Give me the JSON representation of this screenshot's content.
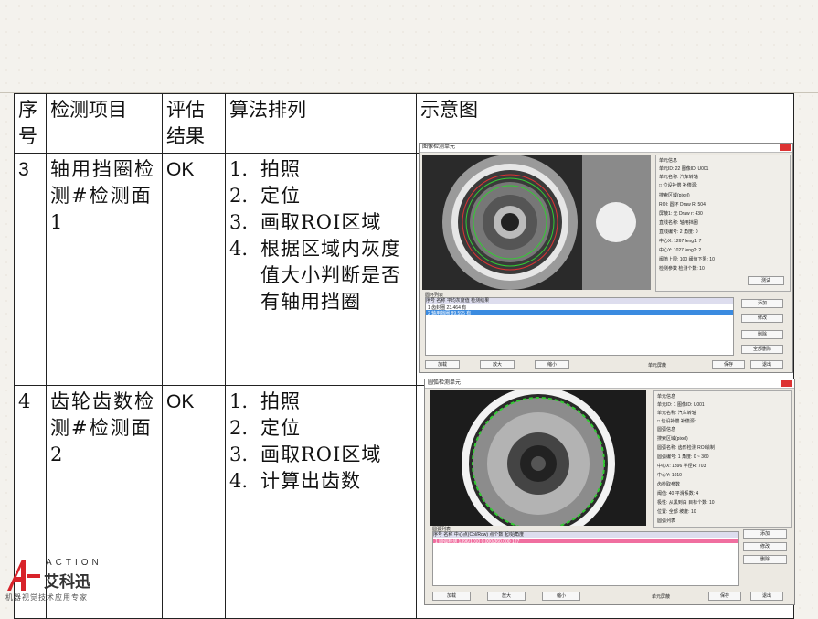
{
  "table": {
    "headers": [
      "序号",
      "检测项目",
      "评估结果",
      "算法排列",
      "示意图"
    ],
    "rows": [
      {
        "seq": "3",
        "item": "轴用挡圈检测#检测面1",
        "result": "OK",
        "steps": [
          {
            "n": "1.",
            "t": "拍照"
          },
          {
            "n": "2.",
            "t": "定位"
          },
          {
            "n": "3.",
            "t": "画取ROI区域"
          },
          {
            "n": "4.",
            "t": "根据区域内灰度值大小判断是否有轴用挡圈"
          }
        ]
      },
      {
        "seq": "4",
        "item": "齿轮齿数检测#检测面2",
        "result": "OK",
        "steps": [
          {
            "n": "1.",
            "t": "拍照"
          },
          {
            "n": "2.",
            "t": "定位"
          },
          {
            "n": "3.",
            "t": "画取ROI区域"
          },
          {
            "n": "4.",
            "t": "计算出齿数"
          }
        ]
      }
    ]
  },
  "shot1": {
    "title": "图像检测单元",
    "fields": [
      "单元信息",
      "单元ID: 22   图像ID: U001",
      "单元名称: 汽车转轴",
      "□ 位设补偿   补偿源:",
      "搜索区域(pixel)",
      "ROI: 圆环   Draw R: 504",
      "屏蔽1: 无   Draw r: 430",
      "直线名称: 轴用挡圈",
      "直线编号: 2   角度: 0",
      "中心X: 1267   leng1: 7",
      "中心Y: 1027   leng2: 2",
      "阈值上限: 100   阈值下限: 10",
      "检测参数  检测个数: 10"
    ],
    "test_btn": "测试",
    "list_label": "圆环列表",
    "list_header": "序号   名称   平均灰度值   检测结果",
    "list_rows": [
      "1   齿封圈   23.464   有",
      "2   轴用挡圈   89.595   有"
    ],
    "side_btns": [
      "添加",
      "修改",
      "删除",
      "全部删除"
    ],
    "bottom_btns": [
      "加载",
      "放大",
      "缩小",
      "单元屏蔽",
      "保存",
      "退出"
    ]
  },
  "shot2": {
    "title": "圆弧检测单元",
    "fields": [
      "单元信息",
      "单元ID: 1   图像ID: U001",
      "单元名称: 汽车转轴",
      "□ 位设补偿   补偿源:",
      "圆弧信息",
      "搜索区域(pixel)",
      "圆弧名称: 齿形检测   ROI绘制",
      "圆弧编号: 1   角度: 0 ~ 360",
      "中心X: 1396   半径R: 703",
      "中心Y: 1010",
      "齿检取参数",
      "阈值: 40   平滑系数: 4",
      "极性: 从黑到白   目标个数: 10",
      "位置: 全部   坡度: 10",
      "圆弧列表"
    ],
    "list_label": "圆弧列表",
    "list_header": "序号   名称   中心点(Col/Row)   点个数   起/始角度",
    "list_rows": [
      "1   圆弧检测   1396/1010   0.000/360.000   127"
    ],
    "side_btns": [
      "添加",
      "修改",
      "删除"
    ],
    "bottom_btns": [
      "加载",
      "放大",
      "缩小",
      "单元屏蔽",
      "保存",
      "退出"
    ]
  },
  "logo": {
    "en": "ACTION",
    "cn": "艾科迅",
    "tagline": "机器视觉技术应用专家"
  },
  "colors": {
    "brand_red": "#d8232a",
    "selection_blue": "#3b8be0",
    "selection_pink": "#f06fa0"
  }
}
